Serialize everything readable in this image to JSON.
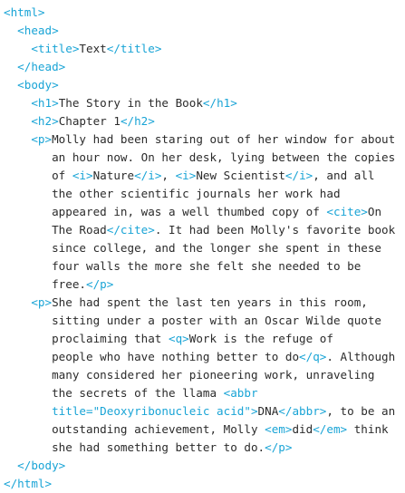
{
  "colors": {
    "tag": "#19a4d6",
    "text": "#2b2b2b",
    "background": "#ffffff"
  },
  "code": {
    "html_open": "<html>",
    "head_open": "<head>",
    "title_open": "<title>",
    "title_text": "Text",
    "title_close": "</title>",
    "head_close": "</head>",
    "body_open": "<body>",
    "h1_open": "<h1>",
    "h1_text": "The Story in the Book",
    "h1_close": "</h1>",
    "h2_open": "<h2>",
    "h2_text": "Chapter 1",
    "h2_close": "</h2>",
    "p1_open": "<p>",
    "p1_l1": "Molly had been staring out of her window for about",
    "p1_l2": "an hour now. On her desk, lying between the copies",
    "p1_l3_a": "of ",
    "i_open": "<i>",
    "i1_text": "Nature",
    "i_close": "</i>",
    "comma_space": ", ",
    "i2_text": "New Scientist",
    "p1_l3_b": ", and all",
    "p1_l4": "the other scientific journals her work had",
    "p1_l5_a": "appeared in, was a well thumbed copy of ",
    "cite_open": "<cite>",
    "cite_text_a": "On",
    "cite_text_b": "The Road",
    "cite_close": "</cite>",
    "p1_l6_b": ". It had been Molly's favorite book",
    "p1_l7": "since college, and the longer she spent in these",
    "p1_l8": "four walls the more she felt she needed to be",
    "p1_l9_a": "free.",
    "p_close": "</p>",
    "p2_open": "<p>",
    "p2_l1": "She had spent the last ten years in this room,",
    "p2_l2": "sitting under a poster with an Oscar Wilde quote",
    "p2_l3_a": "proclaiming that ",
    "q_open": "<q>",
    "q_text_a": "Work is the refuge of",
    "q_text_b": "people who have nothing better to do",
    "q_close": "</q>",
    "p2_l4_b": ". Although",
    "p2_l5": "many considered her pioneering work, unraveling",
    "p2_l6_a": "the secrets of the llama ",
    "abbr_open_a": "<abbr",
    "abbr_open_b": "title=\"Deoxyribonucleic acid\">",
    "abbr_text": "DNA",
    "abbr_close": "</abbr>",
    "p2_l7_b": ", to be an",
    "p2_l8_a": "outstanding achievement, Molly ",
    "em_open": "<em>",
    "em_text": "did",
    "em_close": "</em>",
    "p2_l8_b": " think",
    "p2_l9_a": "she had something better to do.",
    "body_close": "</body>",
    "html_close": "</html>"
  }
}
